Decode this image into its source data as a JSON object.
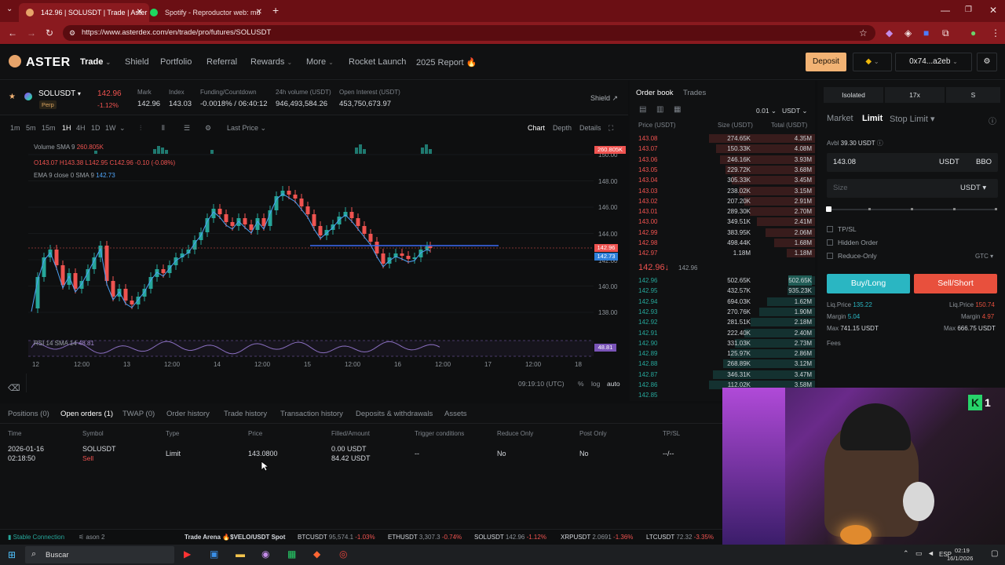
{
  "browser": {
    "tabs": [
      {
        "label": "142.96 | SOLUSDT | Trade | Aster",
        "active": true
      },
      {
        "label": "Spotify - Reproductor web: mú",
        "active": false
      }
    ],
    "url": "https://www.asterdex.com/en/trade/pro/futures/SOLUSDT"
  },
  "header": {
    "logo": "ASTER",
    "nav": [
      "Trade",
      "Shield",
      "Portfolio",
      "Referral",
      "Rewards",
      "More",
      "Rocket Launch",
      "2025 Report"
    ],
    "deposit": "Deposit",
    "wallet": "0x74...a2eb"
  },
  "market": {
    "symbol": "SOLUSDT",
    "type": "Perp",
    "price": "142.96",
    "change": "-1.12%",
    "mark_label": "Mark",
    "mark": "142.96",
    "index_label": "Index",
    "index": "143.03",
    "funding_label": "Funding/Countdown",
    "funding": "-0.0018% / 06:40:12",
    "volume_label": "24h volume (USDT)",
    "volume": "946,493,584.26",
    "oi_label": "Open Interest (USDT)",
    "oi": "453,750,673.97",
    "shield": "Shield"
  },
  "chart_toolbar": {
    "timeframes": [
      "1m",
      "5m",
      "15m",
      "1H",
      "4H",
      "1D",
      "1W"
    ],
    "price_type": "Last Price",
    "views": [
      "Chart",
      "Depth",
      "Details"
    ]
  },
  "chart": {
    "volume_legend": "Volume SMA 9",
    "volume_value": "260.805K",
    "ohlc": "O143.07 H143.38 L142.95 C142.96 -0.10 (-0.08%)",
    "ema_legend": "EMA 9 close 0 SMA 9",
    "ema_value": "142.73",
    "rsi_legend": "RSI 14 SMA 14",
    "rsi_value": "48.81",
    "y_ticks": [
      "150.00",
      "148.00",
      "146.00",
      "144.00",
      "142.00",
      "140.00",
      "138.00"
    ],
    "x_ticks": [
      "12",
      "12:00",
      "13",
      "12:00",
      "14",
      "12:00",
      "15",
      "12:00",
      "16",
      "12:00",
      "17",
      "12:00",
      "18"
    ],
    "last_price_tag": "142.96",
    "ema_tag": "142.73",
    "volume_tag": "260.805K",
    "rsi_tag": "48.81",
    "time": "09:19:10 (UTC)",
    "scale_opts": [
      "%",
      "log",
      "auto"
    ]
  },
  "orderbook": {
    "tabs": [
      "Order book",
      "Trades"
    ],
    "tick": "0.01",
    "unit": "USDT",
    "headers": [
      "Price (USDT)",
      "Size (USDT)",
      "Total (USDT)"
    ],
    "asks": [
      [
        "143.08",
        "274.65K",
        "4.35M"
      ],
      [
        "143.07",
        "150.33K",
        "4.08M"
      ],
      [
        "143.06",
        "246.16K",
        "3.93M"
      ],
      [
        "143.05",
        "229.72K",
        "3.68M"
      ],
      [
        "143.04",
        "305.33K",
        "3.45M"
      ],
      [
        "143.03",
        "238.02K",
        "3.15M"
      ],
      [
        "143.02",
        "207.20K",
        "2.91M"
      ],
      [
        "143.01",
        "289.30K",
        "2.70M"
      ],
      [
        "143.00",
        "349.51K",
        "2.41M"
      ],
      [
        "142.99",
        "383.95K",
        "2.06M"
      ],
      [
        "142.98",
        "498.44K",
        "1.68M"
      ],
      [
        "142.97",
        "1.18M",
        "1.18M"
      ]
    ],
    "mid_price": "142.96↓",
    "mid_mark": "142.96",
    "bids": [
      [
        "142.96",
        "502.65K",
        "502.65K"
      ],
      [
        "142.95",
        "432.57K",
        "935.23K"
      ],
      [
        "142.94",
        "694.03K",
        "1.62M"
      ],
      [
        "142.93",
        "270.76K",
        "1.90M"
      ],
      [
        "142.92",
        "281.51K",
        "2.18M"
      ],
      [
        "142.91",
        "222.40K",
        "2.40M"
      ],
      [
        "142.90",
        "331.03K",
        "2.73M"
      ],
      [
        "142.89",
        "125.97K",
        "2.86M"
      ],
      [
        "142.88",
        "268.89K",
        "3.12M"
      ],
      [
        "142.87",
        "346.31K",
        "3.47M"
      ],
      [
        "142.86",
        "112.02K",
        "3.58M"
      ],
      [
        "142.85",
        "",
        ""
      ]
    ],
    "ask_depth": [
      1.0,
      0.94,
      0.9,
      0.85,
      0.79,
      0.72,
      0.67,
      0.62,
      0.55,
      0.47,
      0.39,
      0.27
    ],
    "bid_depth": [
      0.14,
      0.26,
      0.45,
      0.53,
      0.61,
      0.67,
      0.76,
      0.8,
      0.87,
      0.97,
      1.0,
      0
    ]
  },
  "order_panel": {
    "margin_mode": "Isolated",
    "leverage": "17x",
    "mode": "S",
    "types": [
      "Market",
      "Limit",
      "Stop Limit"
    ],
    "avbl_label": "Avbl",
    "avbl": "39.30 USDT",
    "price_value": "143.08",
    "price_unit": "USDT",
    "bbo": "BBO",
    "size_placeholder": "Size",
    "size_unit": "USDT",
    "options": [
      "TP/SL",
      "Hidden Order",
      "Reduce-Only"
    ],
    "tif": "GTC",
    "buy": "Buy/Long",
    "sell": "Sell/Short",
    "buy_liq_label": "Liq.Price",
    "buy_liq": "135.22",
    "sell_liq_label": "Liq.Price",
    "sell_liq": "150.74",
    "buy_margin_label": "Margin",
    "buy_margin": "5.04",
    "sell_margin_label": "Margin",
    "sell_margin": "4.97",
    "buy_max_label": "Max",
    "buy_max": "741.15 USDT",
    "sell_max_label": "Max",
    "sell_max": "666.75 USDT",
    "fees": "Fees"
  },
  "bottom": {
    "tabs": [
      "Positions (0)",
      "Open orders (1)",
      "TWAP (0)",
      "Order history",
      "Trade history",
      "Transaction history",
      "Deposits & withdrawals",
      "Assets"
    ],
    "headers": [
      "Time",
      "Symbol",
      "Type",
      "Price",
      "Filled/Amount",
      "Trigger conditions",
      "Reduce Only",
      "Post Only",
      "TP/SL"
    ],
    "row": {
      "date": "2026-01-16",
      "time": "02:18:50",
      "symbol": "SOLUSDT",
      "side": "Sell",
      "type": "Limit",
      "price": "143.0800",
      "filled": "0.00 USDT",
      "amount": "84.42 USDT",
      "trigger": "--",
      "reduce": "No",
      "post": "No",
      "tpsl": "--/--"
    }
  },
  "ticker": {
    "connection": "Stable Connection",
    "season": "ason 2",
    "arena": "Trade Arena 🔥$VELO/USDT Spot",
    "items": [
      {
        "sym": "BTCUSDT",
        "price": "95,574.1",
        "chg": "-1.03%"
      },
      {
        "sym": "ETHUSDT",
        "price": "3,307.3",
        "chg": "-0.74%"
      },
      {
        "sym": "SOLUSDT",
        "price": "142.96",
        "chg": "-1.12%"
      },
      {
        "sym": "XRPUSDT",
        "price": "2.0691",
        "chg": "-1.36%"
      },
      {
        "sym": "LTCUSDT",
        "price": "72.32",
        "chg": "-3.35%"
      }
    ]
  },
  "taskbar": {
    "search": "Buscar",
    "lang": "ESP",
    "clock": "02:19",
    "date": "16/1/2026"
  },
  "colors": {
    "up": "#26a69a",
    "down": "#ef5350",
    "accent": "#f2b374",
    "buy": "#2ab6c2",
    "sell": "#e8503d",
    "browser": "#8a1a1f"
  }
}
